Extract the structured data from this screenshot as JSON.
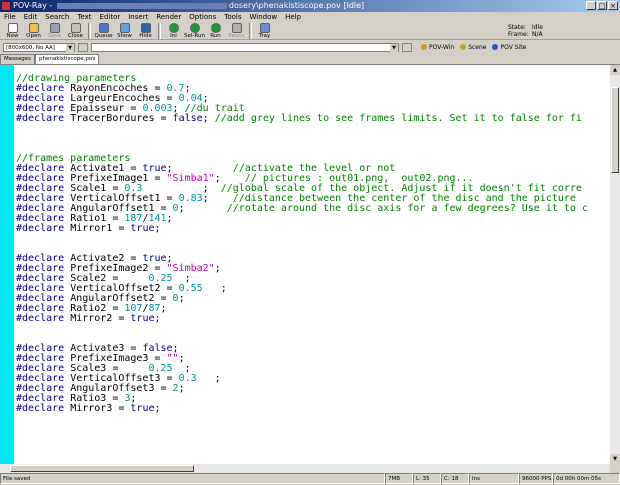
{
  "window": {
    "app_name": "POV-Ray - ",
    "file_path": "dosery\\phenakistiscope.pov [Idle]"
  },
  "menu": [
    "File",
    "Edit",
    "Search",
    "Text",
    "Editor",
    "Insert",
    "Render",
    "Options",
    "Tools",
    "Window",
    "Help"
  ],
  "toolbar": [
    {
      "label": "New",
      "icon": "new-file-icon",
      "color": "#ffffff",
      "enabled": true
    },
    {
      "label": "Open",
      "icon": "open-folder-icon",
      "color": "#e8c24a",
      "enabled": true
    },
    {
      "label": "Save",
      "icon": "save-disk-icon",
      "color": "#9aa0b0",
      "enabled": false
    },
    {
      "label": "Close",
      "icon": "close-doc-icon",
      "color": "#c0c0c0",
      "enabled": true
    },
    {
      "label": "Queue",
      "icon": "queue-icon",
      "color": "#4a7ad0",
      "enabled": true
    },
    {
      "label": "Show",
      "icon": "show-icon",
      "color": "#5fa0e0",
      "enabled": true
    },
    {
      "label": "Hide",
      "icon": "hide-icon",
      "color": "#2f5fb0",
      "enabled": true
    },
    {
      "label": "Ini",
      "icon": "ini-icon",
      "color": "#1c9a3a",
      "enabled": true
    },
    {
      "label": "Sel-Run",
      "icon": "sel-run-icon",
      "color": "#1c9a3a",
      "enabled": true
    },
    {
      "label": "Run",
      "icon": "run-icon",
      "color": "#1c9a3a",
      "enabled": true
    },
    {
      "label": "Pause",
      "icon": "pause-icon",
      "color": "#b0b0b0",
      "enabled": false
    },
    {
      "label": "Tray",
      "icon": "tray-icon",
      "color": "#6a8fcf",
      "enabled": true
    }
  ],
  "status_panel": {
    "state_label": "State:",
    "state_value": "Idle",
    "frame_label": "Frame:",
    "frame_value": "N/A"
  },
  "toolbar2": {
    "resolution": "[800x600, No AA]",
    "links": [
      {
        "label": "POV-Win",
        "icon": "help-icon"
      },
      {
        "label": "Scene",
        "icon": "help-icon"
      },
      {
        "label": "POV Site",
        "icon": "pov-site-icon"
      }
    ]
  },
  "tabs": [
    "Messages",
    "phenakistiscope.pov"
  ],
  "code_lines": [
    [
      {
        "t": "//drawing parameters",
        "c": "cm"
      }
    ],
    [
      {
        "t": "#declare ",
        "c": "kw"
      },
      {
        "t": "RayonEncoches = "
      },
      {
        "t": "0.7",
        "c": "nu"
      },
      {
        "t": ";"
      }
    ],
    [
      {
        "t": "#declare ",
        "c": "kw"
      },
      {
        "t": "LargeurEncoches = "
      },
      {
        "t": "0.04",
        "c": "nu"
      },
      {
        "t": ";"
      }
    ],
    [
      {
        "t": "#declare ",
        "c": "kw"
      },
      {
        "t": "Epaisseur = "
      },
      {
        "t": "0.003",
        "c": "nu"
      },
      {
        "t": "; "
      },
      {
        "t": "//du trait",
        "c": "cm"
      }
    ],
    [
      {
        "t": "#declare ",
        "c": "kw"
      },
      {
        "t": "TracerBordures = "
      },
      {
        "t": "false",
        "c": "kw"
      },
      {
        "t": "; "
      },
      {
        "t": "//add grey lines to see frames limits. Set it to false for fi",
        "c": "cm"
      }
    ],
    [],
    [],
    [],
    [
      {
        "t": "//frames parameters",
        "c": "cm"
      }
    ],
    [
      {
        "t": "#declare ",
        "c": "kw"
      },
      {
        "t": "Activate1 = "
      },
      {
        "t": "true",
        "c": "kw"
      },
      {
        "t": ";          "
      },
      {
        "t": "//activate the level or not",
        "c": "cm"
      }
    ],
    [
      {
        "t": "#declare ",
        "c": "kw"
      },
      {
        "t": "PrefixeImage1 = "
      },
      {
        "t": "\"Simba1\"",
        "c": "st"
      },
      {
        "t": ";    "
      },
      {
        "t": "// pictures : out01.png,  out02.png...",
        "c": "cm"
      }
    ],
    [
      {
        "t": "#declare ",
        "c": "kw"
      },
      {
        "t": "Scale1 = "
      },
      {
        "t": "0.3",
        "c": "nu"
      },
      {
        "t": "          ;  "
      },
      {
        "t": "//global scale of the object. Adjust if it doesn't fit corre",
        "c": "cm"
      }
    ],
    [
      {
        "t": "#declare ",
        "c": "kw"
      },
      {
        "t": "VerticalOffset1 = "
      },
      {
        "t": "0.83",
        "c": "nu"
      },
      {
        "t": ";    "
      },
      {
        "t": "//distance between the center of the disc and the picture",
        "c": "cm"
      }
    ],
    [
      {
        "t": "#declare ",
        "c": "kw"
      },
      {
        "t": "AngularOffset1 = "
      },
      {
        "t": "0",
        "c": "nu"
      },
      {
        "t": ";       "
      },
      {
        "t": "//rotate around the disc axis for a few degrees? Use it to c",
        "c": "cm"
      }
    ],
    [
      {
        "t": "#declare ",
        "c": "kw"
      },
      {
        "t": "Ratio1 = "
      },
      {
        "t": "187",
        "c": "nu"
      },
      {
        "t": "/"
      },
      {
        "t": "141",
        "c": "nu"
      },
      {
        "t": ";"
      }
    ],
    [
      {
        "t": "#declare ",
        "c": "kw"
      },
      {
        "t": "Mirror1 = "
      },
      {
        "t": "true",
        "c": "kw"
      },
      {
        "t": ";"
      }
    ],
    [],
    [],
    [
      {
        "t": "#declare ",
        "c": "kw"
      },
      {
        "t": "Activate2 = "
      },
      {
        "t": "true",
        "c": "kw"
      },
      {
        "t": ";"
      }
    ],
    [
      {
        "t": "#declare ",
        "c": "kw"
      },
      {
        "t": "PrefixeImage2 = "
      },
      {
        "t": "\"Simba2\"",
        "c": "st"
      },
      {
        "t": ";"
      }
    ],
    [
      {
        "t": "#declare ",
        "c": "kw"
      },
      {
        "t": "Scale2 =     "
      },
      {
        "t": "0.25",
        "c": "nu"
      },
      {
        "t": "  ;"
      }
    ],
    [
      {
        "t": "#declare ",
        "c": "kw"
      },
      {
        "t": "VerticalOffset2 = "
      },
      {
        "t": "0.55",
        "c": "nu"
      },
      {
        "t": "   ;"
      }
    ],
    [
      {
        "t": "#declare ",
        "c": "kw"
      },
      {
        "t": "AngularOffset2 = "
      },
      {
        "t": "0",
        "c": "nu"
      },
      {
        "t": ";"
      }
    ],
    [
      {
        "t": "#declare ",
        "c": "kw"
      },
      {
        "t": "Ratio2 = "
      },
      {
        "t": "107",
        "c": "nu"
      },
      {
        "t": "/"
      },
      {
        "t": "87",
        "c": "nu"
      },
      {
        "t": ";"
      }
    ],
    [
      {
        "t": "#declare ",
        "c": "kw"
      },
      {
        "t": "Mirror2 = "
      },
      {
        "t": "true",
        "c": "kw"
      },
      {
        "t": ";"
      }
    ],
    [],
    [],
    [
      {
        "t": "#declare ",
        "c": "kw"
      },
      {
        "t": "Activate3 = "
      },
      {
        "t": "false",
        "c": "kw"
      },
      {
        "t": ";"
      }
    ],
    [
      {
        "t": "#declare ",
        "c": "kw"
      },
      {
        "t": "PrefixeImage3 = "
      },
      {
        "t": "\"\"",
        "c": "st"
      },
      {
        "t": ";"
      }
    ],
    [
      {
        "t": "#declare ",
        "c": "kw"
      },
      {
        "t": "Scale3 =     "
      },
      {
        "t": "0.25",
        "c": "nu"
      },
      {
        "t": "  ;"
      }
    ],
    [
      {
        "t": "#declare ",
        "c": "kw"
      },
      {
        "t": "VerticalOffset3 = "
      },
      {
        "t": "0.3",
        "c": "nu"
      },
      {
        "t": "   ;"
      }
    ],
    [
      {
        "t": "#declare ",
        "c": "kw"
      },
      {
        "t": "AngularOffset3 = "
      },
      {
        "t": "2",
        "c": "nu"
      },
      {
        "t": ";"
      }
    ],
    [
      {
        "t": "#declare ",
        "c": "kw"
      },
      {
        "t": "Ratio3 = "
      },
      {
        "t": "3",
        "c": "nu"
      },
      {
        "t": ";"
      }
    ],
    [
      {
        "t": "#declare ",
        "c": "kw"
      },
      {
        "t": "Mirror3 = "
      },
      {
        "t": "true",
        "c": "kw"
      },
      {
        "t": ";"
      }
    ]
  ],
  "statusbar": {
    "message": "File saved",
    "memory": "7MB",
    "line": "L: 35",
    "col": "C: 18",
    "mode": "Ins",
    "pps": "96000 PPS",
    "time": "0d 00h 00m 05s"
  }
}
